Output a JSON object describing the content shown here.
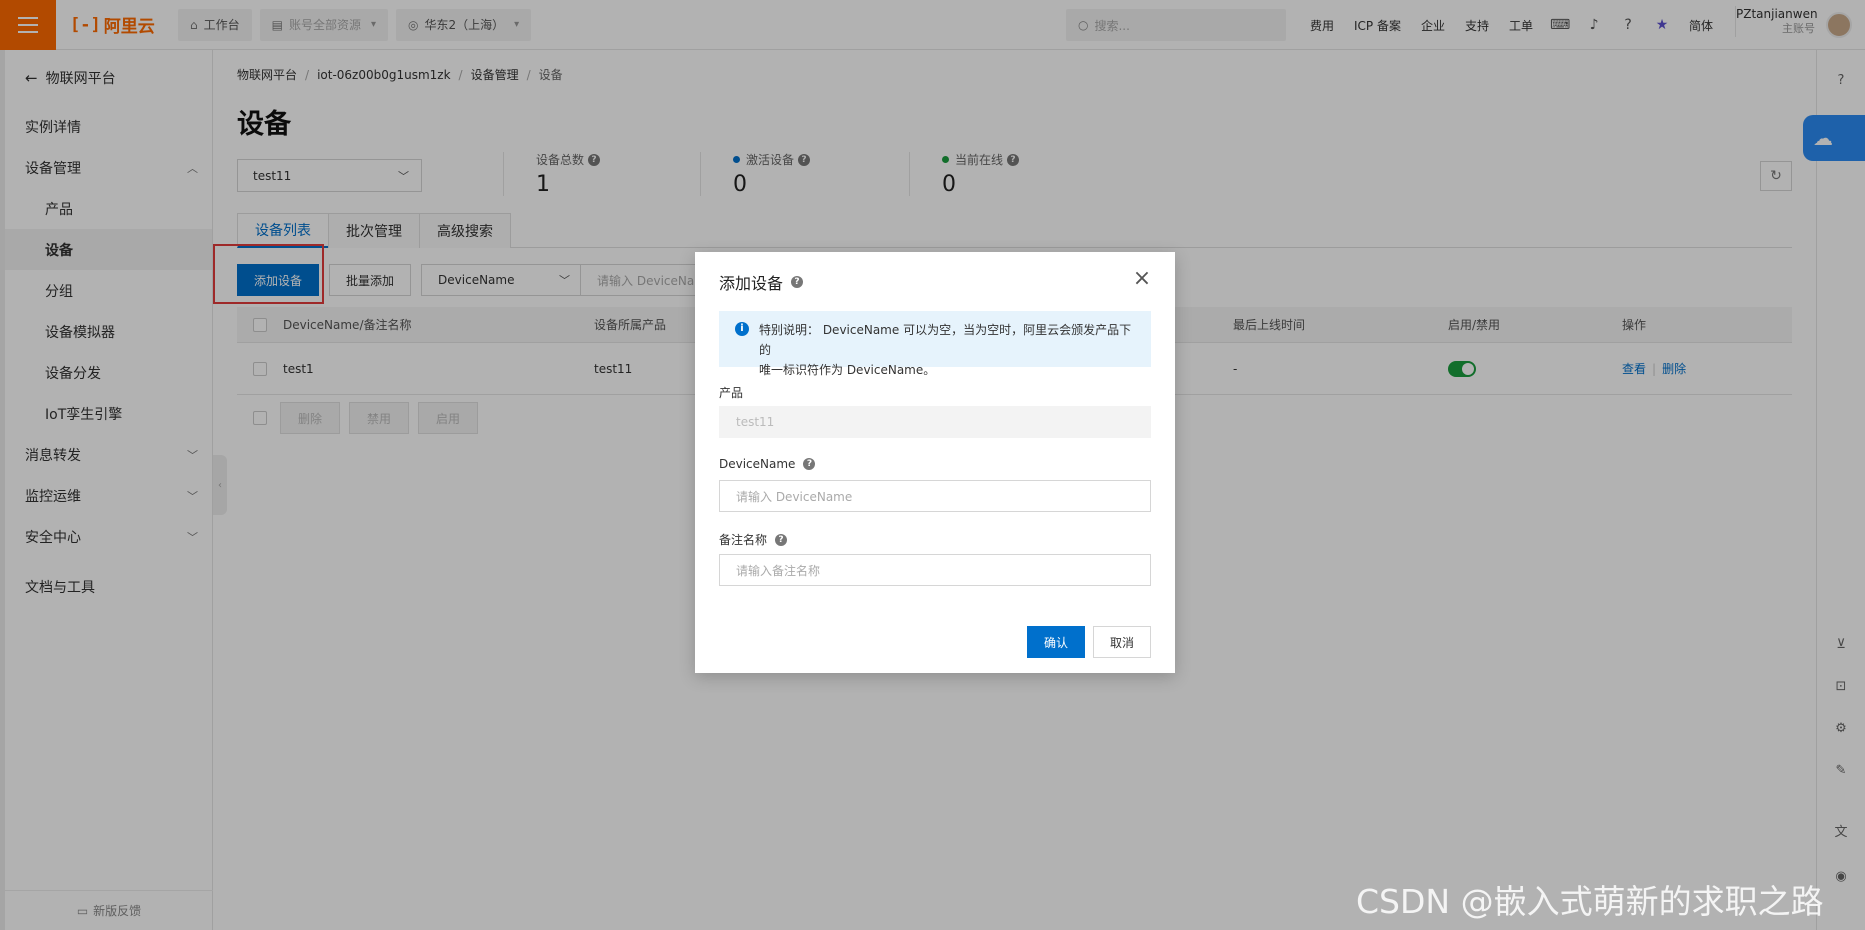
{
  "topbar": {
    "logo_text": "阿里云",
    "workbench": "工作台",
    "account_resources": "账号全部资源",
    "region": "华东2（上海）",
    "search_placeholder": "搜索...",
    "links": [
      "费用",
      "ICP 备案",
      "企业",
      "支持",
      "工单"
    ],
    "language": "简体",
    "user_name": "PZtanjianwen",
    "user_sub": "主账号"
  },
  "sidebar": {
    "back_label": "物联网平台",
    "items": [
      {
        "label": "实例详情"
      },
      {
        "label": "设备管理"
      },
      {
        "label": "产品"
      },
      {
        "label": "设备"
      },
      {
        "label": "分组"
      },
      {
        "label": "设备模拟器"
      },
      {
        "label": "设备分发"
      },
      {
        "label": "IoT孪生引擎"
      },
      {
        "label": "消息转发"
      },
      {
        "label": "监控运维"
      },
      {
        "label": "安全中心"
      },
      {
        "label": "文档与工具"
      }
    ],
    "feedback": "新版反馈"
  },
  "breadcrumb": [
    "物联网平台",
    "iot-06z00b0g1usm1zk",
    "设备管理",
    "设备"
  ],
  "page_title": "设备",
  "product_select": "test11",
  "stats": {
    "total_label": "设备总数",
    "total_value": "1",
    "active_label": "激活设备",
    "active_value": "0",
    "online_label": "当前在线",
    "online_value": "0"
  },
  "tabs": [
    "设备列表",
    "批次管理",
    "高级搜索"
  ],
  "toolbar": {
    "add_device": "添加设备",
    "batch_add": "批量添加",
    "filter_field": "DeviceName",
    "filter_placeholder": "请输入 DeviceName"
  },
  "table": {
    "headers": {
      "name": "DeviceName/备注名称",
      "product": "设备所属产品",
      "last_online": "最后上线时间",
      "enable": "启用/禁用",
      "actions": "操作"
    },
    "rows": [
      {
        "name": "test1",
        "product": "test11",
        "last_online": "-",
        "enabled": true,
        "view": "查看",
        "delete": "删除"
      }
    ],
    "batch_buttons": [
      "删除",
      "禁用",
      "启用"
    ]
  },
  "modal": {
    "title": "添加设备",
    "notice_line1": "特别说明： DeviceName 可以为空，当为空时，阿里云会颁发产品下的",
    "notice_line2": "唯一标识符作为 DeviceName。",
    "product_label": "产品",
    "product_value": "test11",
    "devicename_label": "DeviceName",
    "devicename_placeholder": "请输入 DeviceName",
    "remark_label": "备注名称",
    "remark_placeholder": "请输入备注名称",
    "confirm": "确认",
    "cancel": "取消"
  },
  "watermark": "CSDN @嵌入式萌新的求职之路",
  "colors": {
    "brand_orange": "#ff6a00",
    "primary_blue": "#0070cc",
    "toggle_green": "#1b9e3e",
    "highlight_red": "#e23b3b"
  }
}
